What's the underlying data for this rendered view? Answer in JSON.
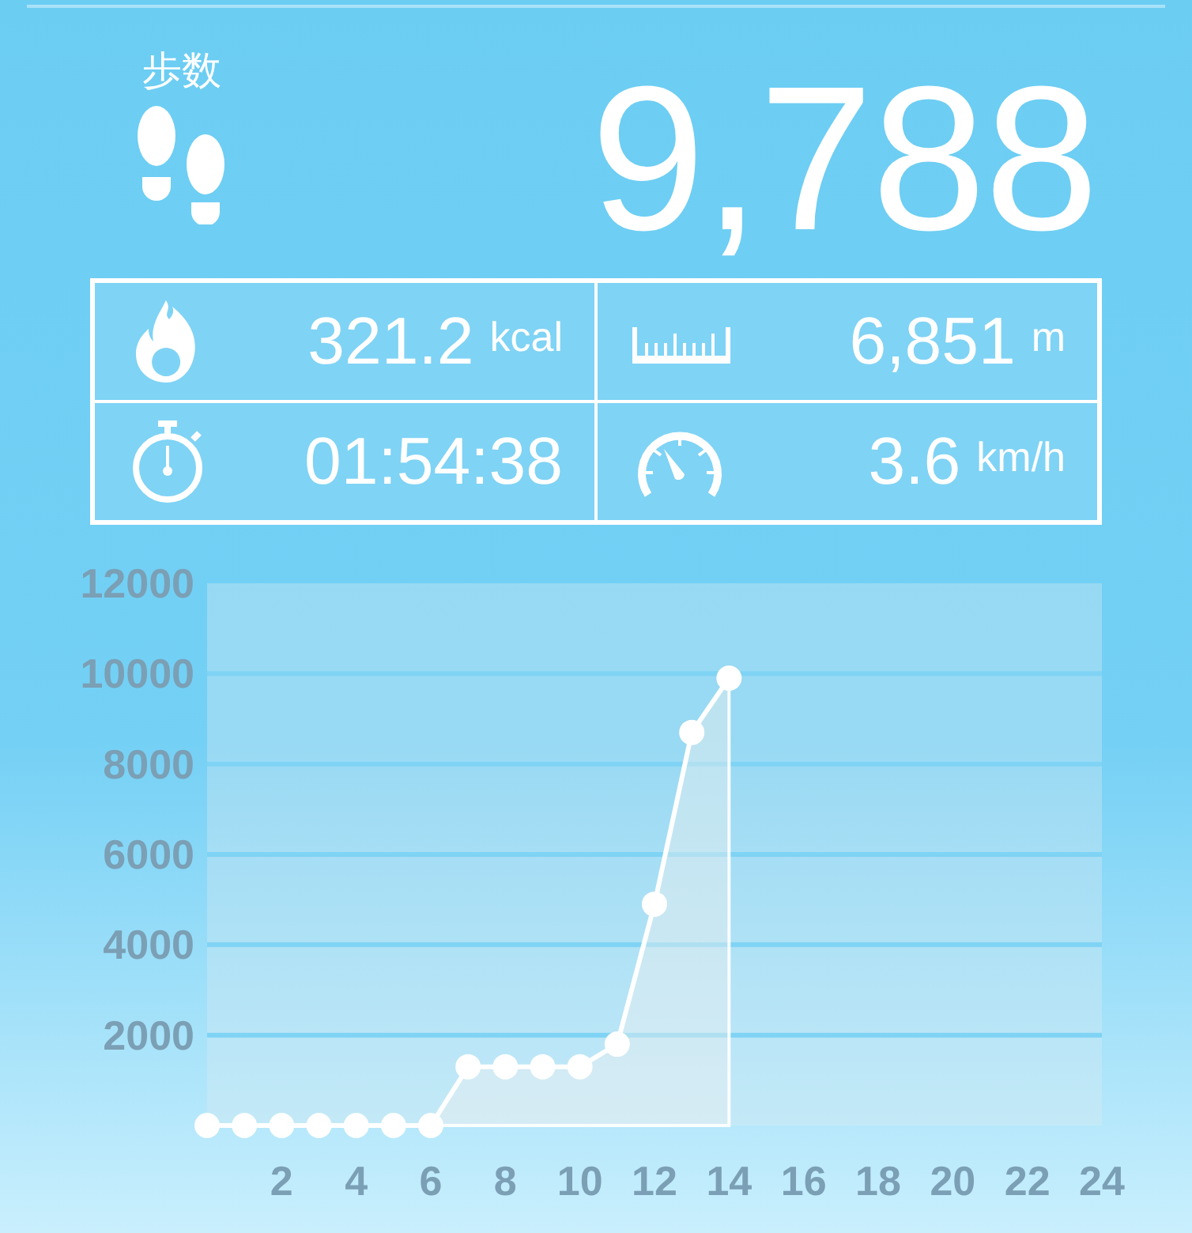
{
  "header": {
    "label": "歩数",
    "steps": "9,788"
  },
  "stats": [
    {
      "kind": "calories",
      "value": "321.2",
      "unit": "kcal"
    },
    {
      "kind": "distance",
      "value": "6,851",
      "unit": "m"
    },
    {
      "kind": "time",
      "value": "01:54:38"
    },
    {
      "kind": "speed",
      "value": "3.6",
      "unit": "km/h"
    }
  ],
  "chart": {
    "chart_data": {
      "type": "area",
      "x": [
        0,
        1,
        2,
        3,
        4,
        5,
        6,
        7,
        8,
        9,
        10,
        11,
        12,
        13,
        14
      ],
      "values": [
        0,
        0,
        0,
        0,
        0,
        0,
        0,
        1300,
        1300,
        1300,
        1300,
        1800,
        4900,
        8700,
        9900
      ],
      "grid": true,
      "xlim": [
        0,
        24
      ],
      "ylim": [
        0,
        12000
      ],
      "xticks": [
        2,
        4,
        6,
        8,
        10,
        12,
        14,
        16,
        18,
        20,
        22,
        24
      ],
      "yticks": [
        2000,
        4000,
        6000,
        8000,
        10000,
        12000
      ]
    }
  }
}
